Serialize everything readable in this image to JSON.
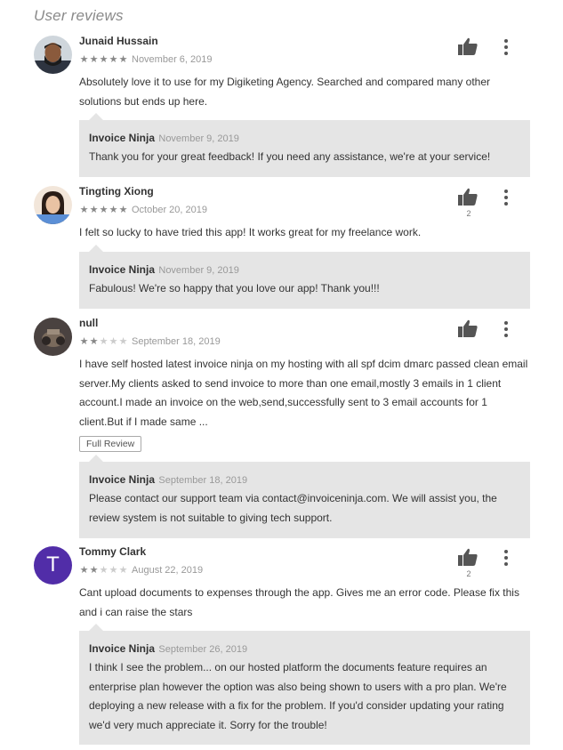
{
  "section_title": "User reviews",
  "colors": {
    "reply_bg": "#e5e5e5",
    "avatar_t": "#512da8"
  },
  "reviews": [
    {
      "author": "Junaid Hussain",
      "stars": 5,
      "date": "November 6, 2019",
      "text": "Absolutely love it to use for my Digiketing Agency. Searched and compared many other solutions but ends up here.",
      "likes": "",
      "reply": {
        "author": "Invoice Ninja",
        "date": "November 9, 2019",
        "text": "Thank you for your great feedback! If you need any assistance, we're at your service!"
      }
    },
    {
      "author": "Tingting Xiong",
      "stars": 5,
      "date": "October 20, 2019",
      "text": "I felt so lucky to have tried this app! It works great for my freelance work.",
      "likes": "2",
      "reply": {
        "author": "Invoice Ninja",
        "date": "November 9, 2019",
        "text": "Fabulous! We're so happy that you love our app! Thank you!!!"
      }
    },
    {
      "author": "null",
      "stars": 2,
      "date": "September 18, 2019",
      "text": "I have self hosted latest invoice ninja on my hosting with all spf dcim dmarc passed clean email server.My clients asked to send invoice to more than one email,mostly 3 emails in 1 client account.I made an invoice on the web,send,successfully sent to 3 email accounts for 1 client.But if I made same ...",
      "likes": "",
      "full_review_label": "Full Review",
      "reply": {
        "author": "Invoice Ninja",
        "date": "September 18, 2019",
        "text": "Please contact our support team via contact@invoiceninja.com. We will assist you, the review system is not suitable to giving tech support."
      }
    },
    {
      "author": "Tommy Clark",
      "stars": 2,
      "date": "August 22, 2019",
      "text": "Cant upload documents to expenses through the app. Gives me an error code. Please fix this and i can raise the stars",
      "likes": "2",
      "avatar_letter": "T",
      "reply": {
        "author": "Invoice Ninja",
        "date": "September 26, 2019",
        "text": "I think I see the problem... on our hosted platform the documents feature requires an enterprise plan however the option was also being shown to users with a pro plan. We're deploying a new release with a fix for the problem. If you'd consider updating your rating we'd very much appreciate it. Sorry for the trouble!"
      }
    }
  ]
}
